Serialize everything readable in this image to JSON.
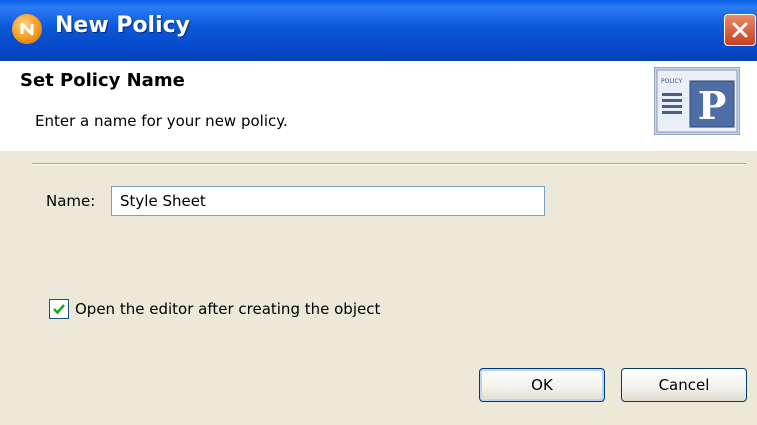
{
  "window": {
    "title": "New Policy",
    "icons": {
      "app": "novell-n-icon",
      "close": "close-icon"
    }
  },
  "header": {
    "title": "Set Policy Name",
    "description": "Enter a name for your new policy.",
    "icon": "policy-document-icon",
    "icon_caption": "POLICY",
    "icon_letter": "P"
  },
  "form": {
    "name_label": "Name:",
    "name_value": "Style Sheet",
    "open_editor_label": "Open the editor after creating the object",
    "open_editor_checked": true
  },
  "buttons": {
    "ok_label": "OK",
    "cancel_label": "Cancel"
  },
  "colors": {
    "titlebar": "#0a58d8",
    "dialog_bg": "#ece9d8",
    "close_button": "#c8401f"
  }
}
